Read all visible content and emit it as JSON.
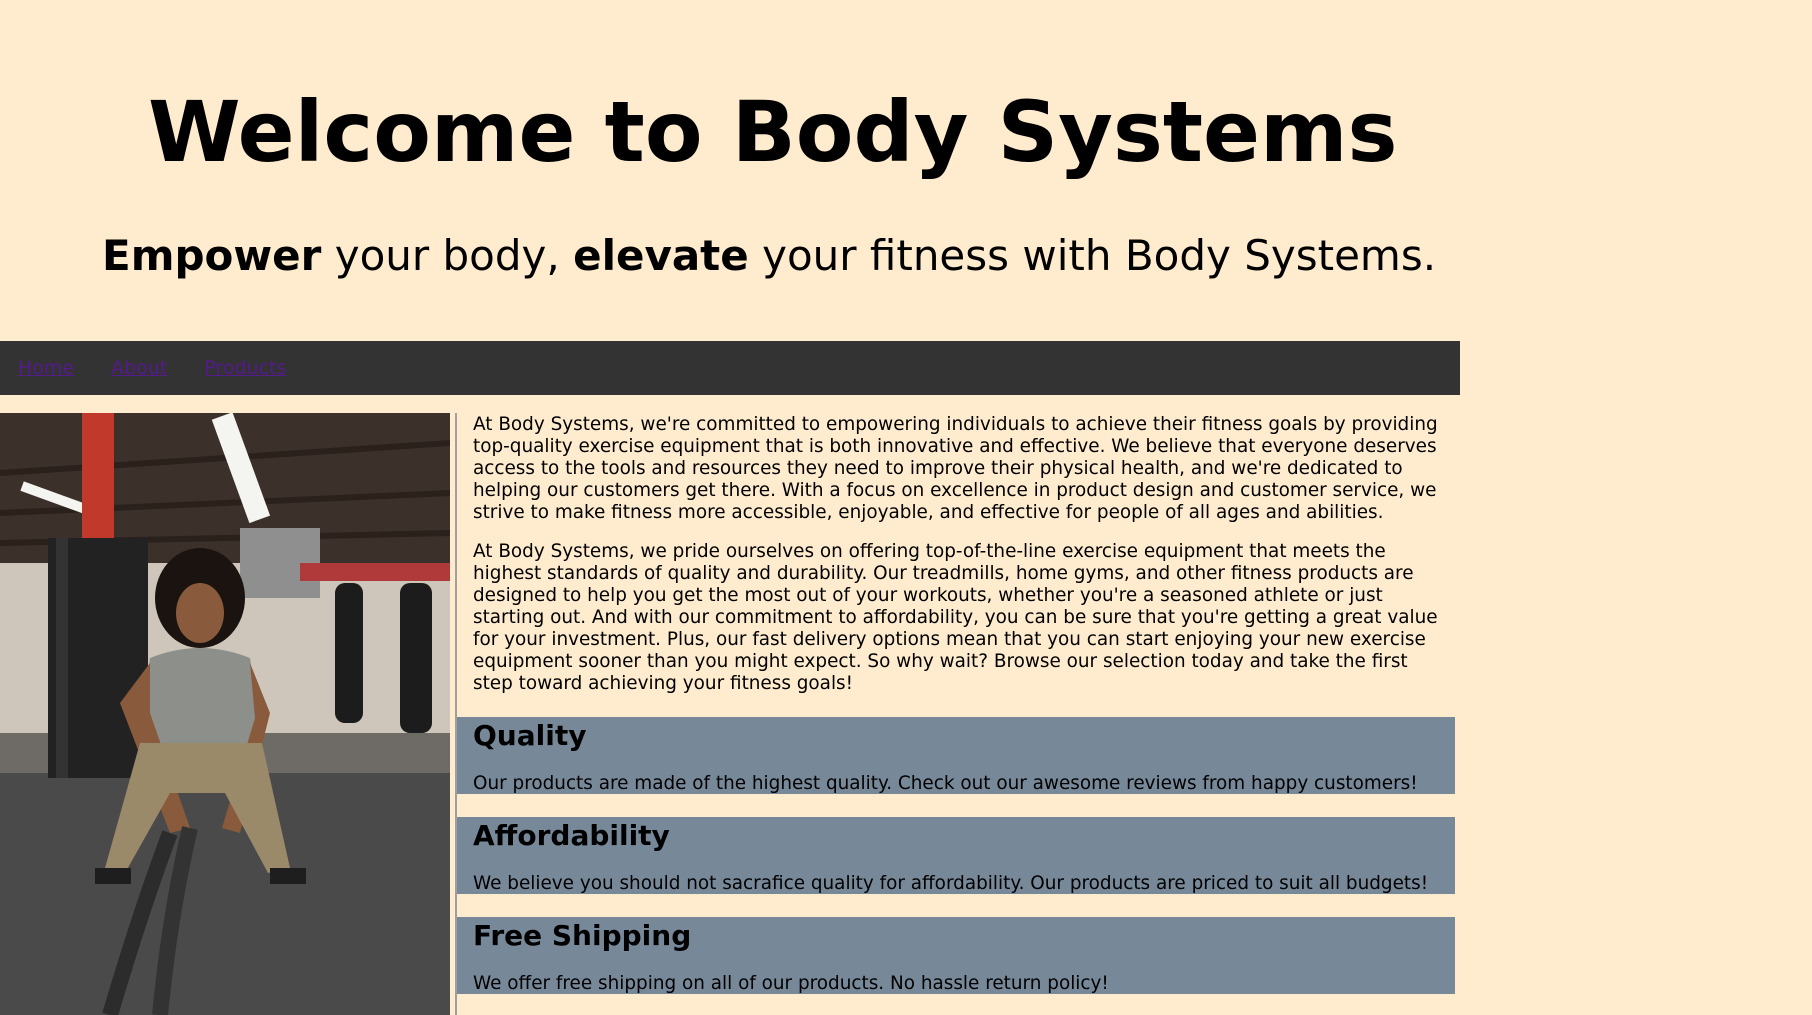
{
  "header": {
    "title": "Welcome to Body Systems",
    "tagline": {
      "word1": "Empower",
      "text1": " your body, ",
      "word2": "elevate",
      "text2": " your fitness with Body Systems."
    }
  },
  "nav": {
    "items": [
      {
        "label": "Home"
      },
      {
        "label": "About"
      },
      {
        "label": "Products"
      }
    ]
  },
  "main": {
    "paragraphs": [
      "At Body Systems, we're committed to empowering individuals to achieve their fitness goals by providing top-quality exercise equipment that is both innovative and effective. We believe that everyone deserves access to the tools and resources they need to improve their physical health, and we're dedicated to helping our customers get there. With a focus on excellence in product design and customer service, we strive to make fitness more accessible, enjoyable, and effective for people of all ages and abilities.",
      "At Body Systems, we pride ourselves on offering top-of-the-line exercise equipment that meets the highest standards of quality and durability. Our treadmills, home gyms, and other fitness products are designed to help you get the most out of your workouts, whether you're a seasoned athlete or just starting out. And with our commitment to affordability, you can be sure that you're getting a great value for your investment. Plus, our fast delivery options mean that you can start enjoying your new exercise equipment sooner than you might expect. So why wait? Browse our selection today and take the first step toward achieving your fitness goals!"
    ],
    "features": [
      {
        "title": "Quality",
        "text": "Our products are made of the highest quality. Check out our awesome reviews from happy customers!"
      },
      {
        "title": "Affordability",
        "text": "We believe you should not sacrafice quality for affordability. Our products are priced to suit all budgets!"
      },
      {
        "title": "Free Shipping",
        "text": "We offer free shipping on all of our products. No hassle return policy!"
      }
    ]
  },
  "colors": {
    "background": "#ffebcd",
    "navbar": "#333333",
    "nav_link": "#551a8b",
    "feature_box": "#778899"
  }
}
